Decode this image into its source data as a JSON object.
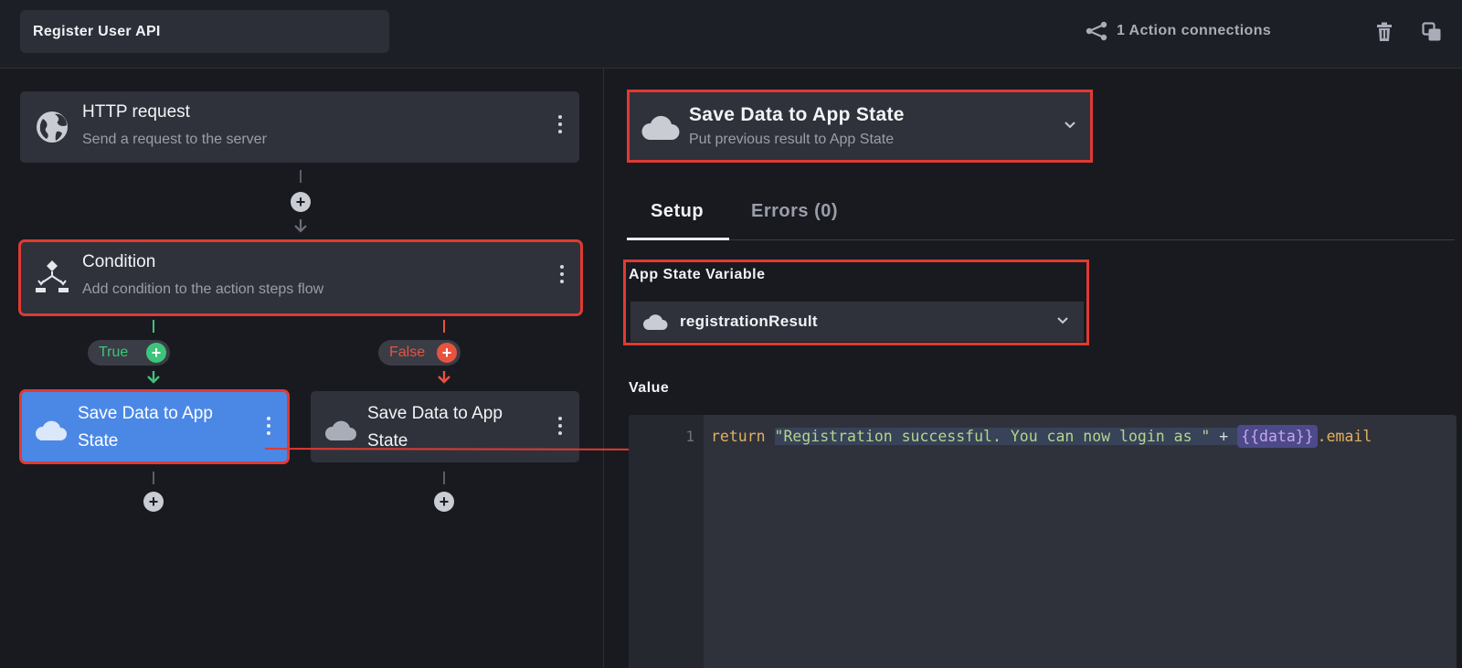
{
  "header": {
    "title": "Register User API",
    "connections_label": "1 Action connections"
  },
  "flow": {
    "http_node": {
      "title": "HTTP request",
      "subtitle": "Send a request to the server"
    },
    "condition_node": {
      "title": "Condition",
      "subtitle": "Add condition to the action steps flow"
    },
    "true_label": "True",
    "false_label": "False",
    "true_branch_node": {
      "title": "Save Data to App State",
      "selected": true
    },
    "false_branch_node": {
      "title": "Save Data to App State"
    }
  },
  "panel": {
    "action": {
      "title": "Save Data to App State",
      "subtitle": "Put previous result to App State"
    },
    "tabs": [
      {
        "label": "Setup",
        "active": true
      },
      {
        "label": "Errors (0)",
        "active": false
      }
    ],
    "app_state_label": "App State Variable",
    "app_state_value": "registrationResult",
    "value_label": "Value",
    "editor": {
      "line_number": "1",
      "keyword": "return",
      "string": "\"Registration successful. You can now login as \"",
      "operator": " + ",
      "template": "{{data}}",
      "property": ".email"
    }
  },
  "colors": {
    "highlight": "#e03a33",
    "selected_node": "#4b88e6",
    "true_green": "#3ec47a",
    "false_red": "#e8533f"
  },
  "icons": [
    "share-icon",
    "trash-icon",
    "copy-icon",
    "globe-icon",
    "condition-icon",
    "cloud-icon",
    "more-vertical-icon",
    "plus-icon",
    "chevron-down-icon"
  ]
}
